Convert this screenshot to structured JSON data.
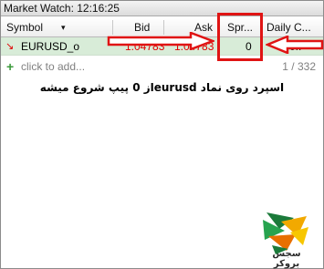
{
  "window": {
    "title": "Market Watch: 12:16:25"
  },
  "columns": {
    "symbol": "Symbol",
    "bid": "Bid",
    "ask": "Ask",
    "spread": "Spr...",
    "daily_change": "Daily C..."
  },
  "rows": [
    {
      "symbol": "EURUSD_o",
      "bid": "1.04783",
      "ask": "1.04783",
      "spread": "0",
      "daily_change": "-0.."
    }
  ],
  "add_row": {
    "label": "click to add...",
    "count": "1 / 332"
  },
  "annotation": {
    "text": "اسپرد روی نماد eurusdاز 0 پیپ شروع میشه"
  },
  "logo": {
    "text": "سجس بروکر"
  },
  "colors": {
    "highlight": "#e01414",
    "row_bg": "#d8ecd8",
    "price": "#e00000"
  }
}
